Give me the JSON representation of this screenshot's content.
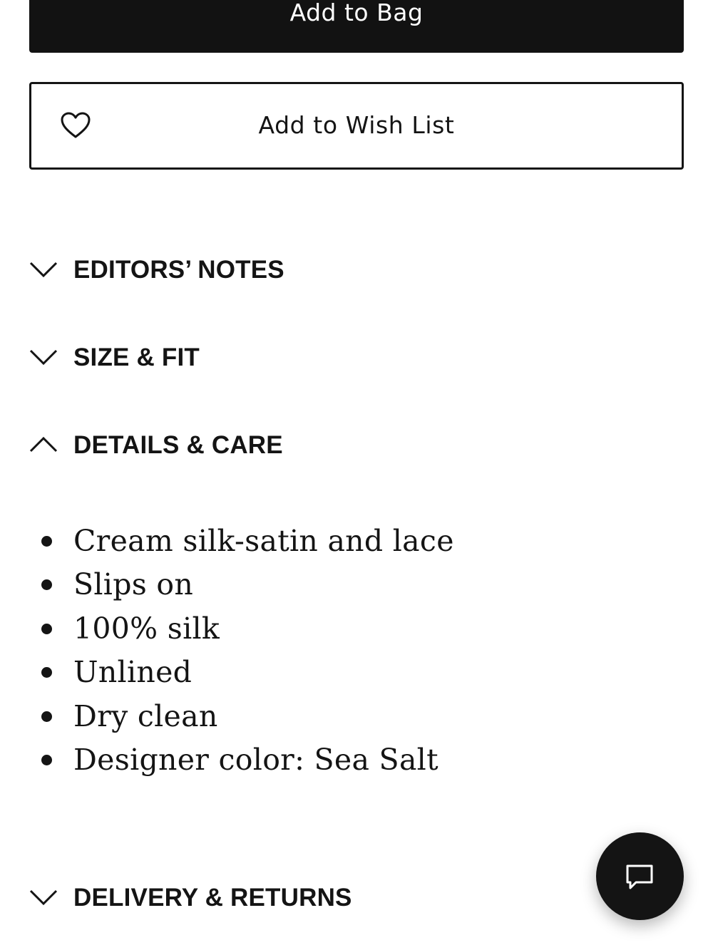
{
  "actions": {
    "add_to_bag_label": "Add to Bag",
    "add_to_wish_list_label": "Add to Wish List"
  },
  "accordion": {
    "editors_notes": {
      "title": "EDITORS’ NOTES",
      "state": "collapsed"
    },
    "size_fit": {
      "title": "SIZE & FIT",
      "state": "collapsed"
    },
    "details_care": {
      "title": "DETAILS & CARE",
      "state": "expanded",
      "items": [
        "Cream silk-satin and lace",
        "Slips on",
        "100% silk",
        "Unlined",
        "Dry clean",
        "Designer color: Sea Salt"
      ]
    },
    "delivery_returns": {
      "title": "DELIVERY & RETURNS",
      "state": "collapsed"
    }
  },
  "icons": {
    "wish_list": "heart-icon",
    "collapsed": "chevron-down-icon",
    "expanded": "chevron-up-icon",
    "chat": "chat-bubble-icon"
  },
  "colors": {
    "primary_button_bg": "#121212",
    "primary_button_text": "#ffffff",
    "text": "#141414",
    "background": "#ffffff"
  }
}
